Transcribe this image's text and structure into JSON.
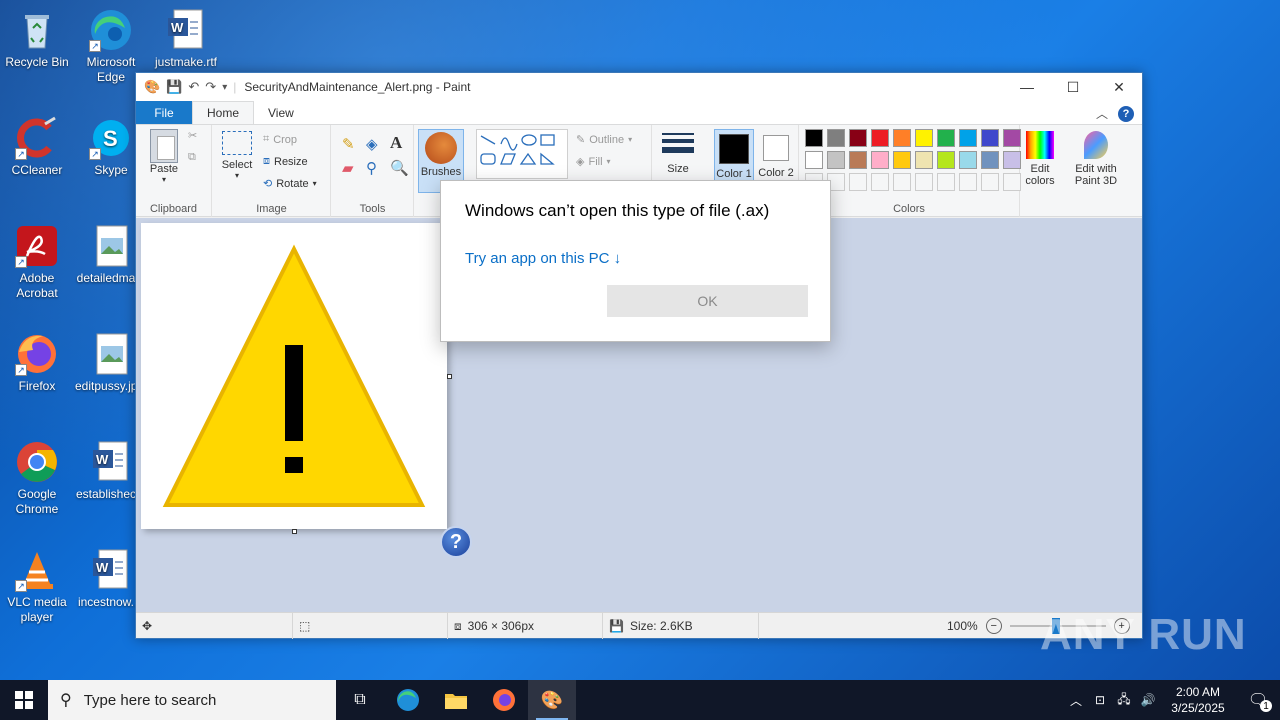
{
  "desktop": {
    "icons": [
      {
        "label": "Recycle Bin",
        "icon": "recycle-bin-icon"
      },
      {
        "label": "Microsoft Edge",
        "icon": "edge-icon"
      },
      {
        "label": "justmake.rtf",
        "icon": "word-document-icon"
      },
      {
        "label": "CCleaner",
        "icon": "ccleaner-icon"
      },
      {
        "label": "Skype",
        "icon": "skype-icon"
      },
      {
        "label": "Adobe Acrobat",
        "icon": "acrobat-icon"
      },
      {
        "label": "detailedma...",
        "icon": "image-file-icon"
      },
      {
        "label": "Firefox",
        "icon": "firefox-icon"
      },
      {
        "label": "editpussy.jp...",
        "icon": "image-file-icon"
      },
      {
        "label": "Google Chrome",
        "icon": "chrome-icon"
      },
      {
        "label": "establishec...",
        "icon": "word-document-icon"
      },
      {
        "label": "VLC media player",
        "icon": "vlc-icon"
      },
      {
        "label": "incestnow....",
        "icon": "word-document-icon"
      }
    ]
  },
  "paint": {
    "title": "SecurityAndMaintenance_Alert.png - Paint",
    "tabs": {
      "file": "File",
      "home": "Home",
      "view": "View"
    },
    "ribbon": {
      "clipboard": {
        "paste": "Paste",
        "label": "Clipboard"
      },
      "image": {
        "select": "Select",
        "crop": "Crop",
        "resize": "Resize",
        "rotate": "Rotate",
        "label": "Image"
      },
      "tools": {
        "label": "Tools"
      },
      "brushes": "Brushes",
      "shapes": {
        "outline": "Outline",
        "fill": "Fill"
      },
      "size": "Size",
      "color1": "Color 1",
      "color2": "Color 2",
      "colors_label": "Colors",
      "edit_colors": "Edit colors",
      "edit_paint3d": "Edit with Paint 3D",
      "palette_row1": [
        "#000000",
        "#7f7f7f",
        "#880015",
        "#ed1c24",
        "#ff7f27",
        "#fff200",
        "#22b14c",
        "#00a2e8",
        "#3f48cc",
        "#a349a4"
      ],
      "palette_row2": [
        "#ffffff",
        "#c3c3c3",
        "#b97a57",
        "#ffaec9",
        "#ffc90e",
        "#efe4b0",
        "#b5e61d",
        "#99d9ea",
        "#7092be",
        "#c8bfe7"
      ]
    },
    "status": {
      "dimensions": "306 × 306px",
      "size": "Size: 2.6KB",
      "zoom": "100%"
    }
  },
  "dialog": {
    "title": "Windows can’t open this type of file (.ax)",
    "link": "Try an app on this PC ↓",
    "ok": "OK"
  },
  "taskbar": {
    "search_placeholder": "Type here to search",
    "time": "2:00 AM",
    "date": "3/25/2025",
    "notification_count": "1"
  },
  "watermark": "ANY RUN"
}
